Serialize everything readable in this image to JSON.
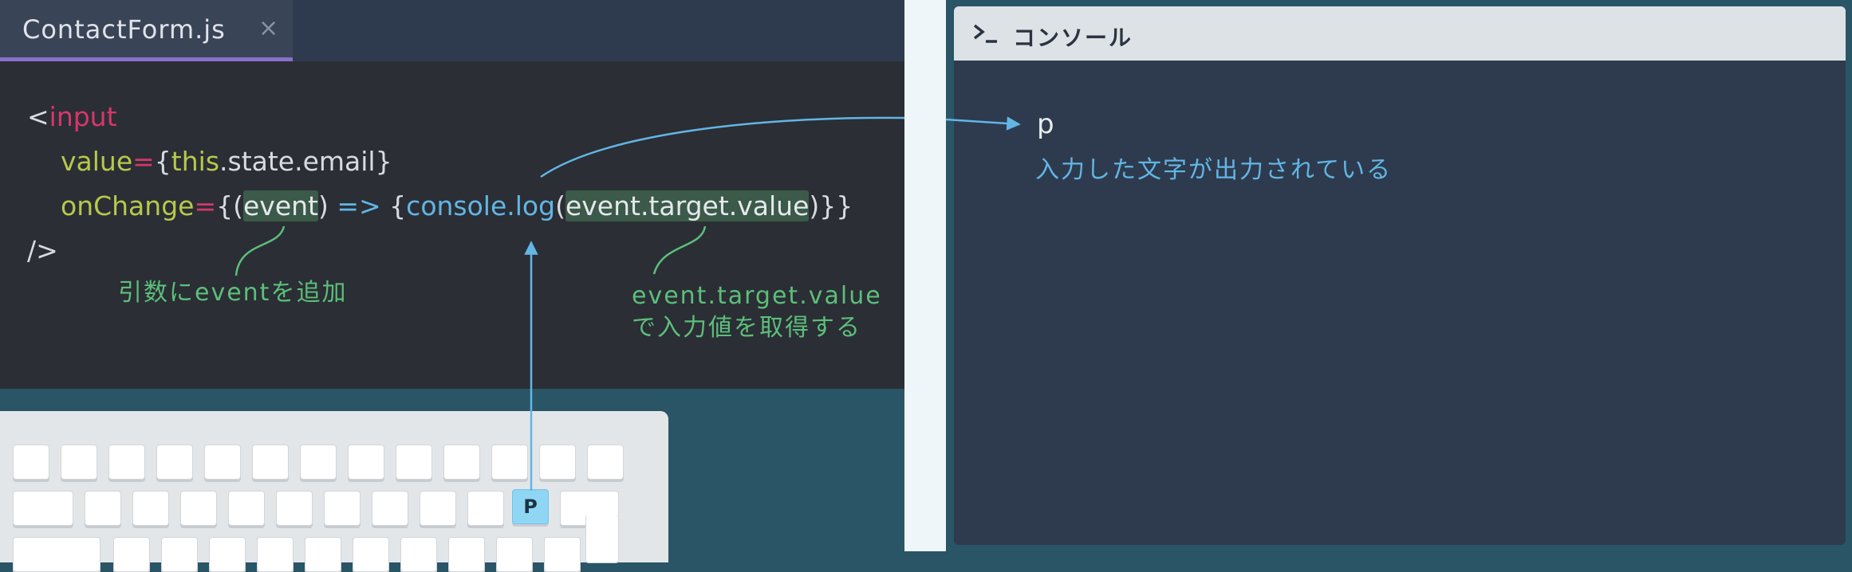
{
  "editor": {
    "tab_title": "ContactForm.js",
    "tab_close": "×",
    "code": {
      "l1_open": "<",
      "l1_tag": "input",
      "l2_attr": "value",
      "l2_eq": "=",
      "l2_open": "{",
      "l2_this": "this",
      "l2_rest": ".state.email",
      "l2_close": "}",
      "l3_attr": "onChange",
      "l3_eq": "=",
      "l3_open": "{(",
      "l3_event": "event",
      "l3_paren": ")",
      "l3_arrow": "=>",
      "l3_brace": "{",
      "l3_console": "console.log",
      "l3_lparen": "(",
      "l3_value": "event.target.value",
      "l3_end": ")}}",
      "l4_close": "/>"
    },
    "note_event": "引数にeventを追加",
    "note_value_1": "event.target.value",
    "note_value_2": "で入力値を取得する"
  },
  "keyboard": {
    "active_key": "P"
  },
  "console": {
    "title": "コンソール",
    "output": "p",
    "note": "入力した文字が出力されている"
  },
  "colors": {
    "tag": "#d6376a",
    "attr": "#b7c94b",
    "function": "#62b6e5",
    "annotation": "#5cbf7a",
    "highlight": "#3b5a49"
  },
  "icons": {
    "tab_close": "close-icon",
    "console": "terminal-icon"
  }
}
